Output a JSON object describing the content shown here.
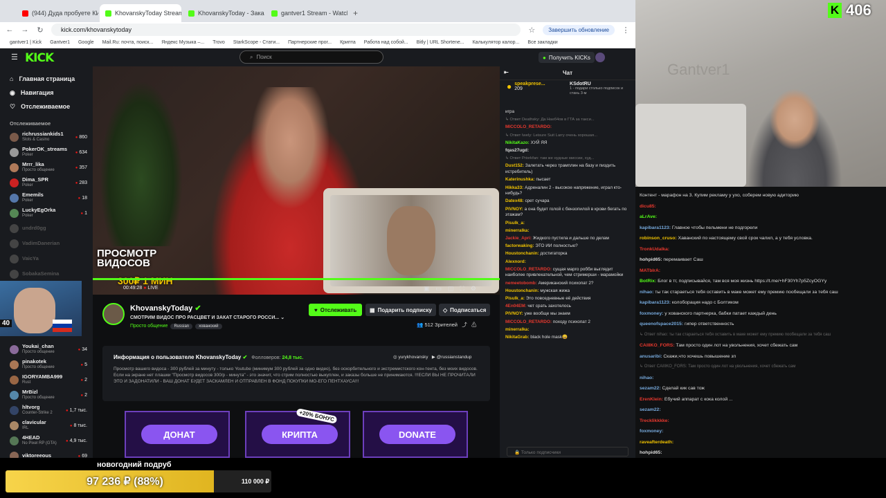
{
  "browser": {
    "tabs": [
      {
        "title": "(944) Дуда пробуете КИТАЙСК",
        "color": "#ff0000"
      },
      {
        "title": "KhovanskyToday Stream - Watch",
        "color": "#53fc18",
        "active": true
      },
      {
        "title": "KhovanskyToday - Заказ подпис",
        "color": "#53fc18"
      },
      {
        "title": "gantver1 Stream - Watch Live о",
        "color": "#53fc18"
      }
    ],
    "url": "kick.com/khovanskytoday",
    "update_label": "Завершить обновление",
    "bookmarks": [
      "gantver1 | Kick",
      "Gantver1",
      "Google",
      "Mail.Ru: почта, поиск...",
      "Яндекс Музыка –...",
      "Trovo",
      "StarkScope - Стати...",
      "Партнерские прог...",
      "Крипта",
      "Работа над собой...",
      "Bitly | URL Shortene...",
      "Калькулятор калор...",
      "Все закладки"
    ]
  },
  "kick": {
    "logo": "KICK",
    "search_placeholder": "Поиск",
    "get_kicks": "Получить KICKs",
    "nav": [
      {
        "label": "Главная страница",
        "icon": "home-icon"
      },
      {
        "label": "Навигация",
        "icon": "compass-icon"
      },
      {
        "label": "Отслеживаемое",
        "icon": "heart-icon"
      }
    ],
    "following_title": "Отслеживаемое",
    "following": [
      {
        "name": "richrussiankids1",
        "cat": "Slots & Casino",
        "count": "860",
        "color": "#7a5a4a"
      },
      {
        "name": "PokerOK_streams",
        "cat": "Poker",
        "count": "634",
        "color": "#999999"
      },
      {
        "name": "Mrrr_lika",
        "cat": "Просто общение",
        "count": "357",
        "color": "#b07a5a"
      },
      {
        "name": "Dima_SPR",
        "cat": "Poker",
        "count": "283",
        "color": "#cc2222"
      },
      {
        "name": "Ememils",
        "cat": "Poker",
        "count": "18",
        "color": "#5577aa"
      },
      {
        "name": "LuckyEgOrka",
        "cat": "Poker",
        "count": "1",
        "color": "#558855"
      },
      {
        "name": "undrd0gg",
        "cat": "",
        "count": "",
        "color": "#444444",
        "off": true
      },
      {
        "name": "VadimDanerian",
        "cat": "",
        "count": "",
        "color": "#444444",
        "off": true
      },
      {
        "name": "VaicYa",
        "cat": "",
        "count": "",
        "color": "#444444",
        "off": true
      },
      {
        "name": "SobakaSemina",
        "cat": "",
        "count": "",
        "color": "#444444",
        "off": true
      }
    ],
    "following2": [
      {
        "name": "Youkai_chan",
        "cat": "Просто общение",
        "count": "34",
        "color": "#8a6a9a"
      },
      {
        "name": "pinakotek",
        "cat": "Просто общение",
        "count": "5",
        "color": "#aa7755"
      },
      {
        "name": "IGORYAMBA999",
        "cat": "Rust",
        "count": "2",
        "color": "#996644"
      },
      {
        "name": "MrBizl",
        "cat": "Просто общение",
        "count": "2",
        "color": "#5588aa"
      },
      {
        "name": "hltvorg",
        "cat": "Counter-Strike 2",
        "count": "1,7 тыс.",
        "color": "#334466"
      },
      {
        "name": "clavicular",
        "cat": "IRL",
        "count": "8 тыс.",
        "color": "#aa8866"
      },
      {
        "name": "4HEAD",
        "cat": "No Pixel RP (GTA)",
        "count": "4,9 тыс.",
        "color": "#557755"
      },
      {
        "name": "viktoreeous",
        "cat": "",
        "count": "69",
        "color": "#886655"
      }
    ],
    "side_overlay_num": "40"
  },
  "video": {
    "promo_title": "ПРОСМОТР ВИДОСОВ",
    "promo_price": "300₽ 1 МИН",
    "time": "00:49:28",
    "live": "LIVE"
  },
  "channel": {
    "name": "KhovanskyToday",
    "title": "СМОТРИМ ВИДОС ПРО РАСЦВЕТ И ЗАКАТ СТАРОГО РОССИ...",
    "category": "Просто общение",
    "tags": [
      "Russian",
      "хованский"
    ],
    "follow_btn": "Отслеживать",
    "gift_btn": "Подарить подписку",
    "sub_btn": "Подписаться",
    "viewers": "512 Зрителей"
  },
  "about": {
    "title": "Информация о пользователе KhovanskyToday",
    "followers_label": "Фолловеров:",
    "followers": "24,8 тыс.",
    "socials": [
      "yurykhovansky",
      "@russianstandup"
    ],
    "text": "Просмотр вашего видоса - 300 рублей за минуту - только Youtube (минимум 300 рублей за одно видео), без оскорбительного и экстремистского кон-тента, без моих видосов. Если на экране нет плашки \"Просмотр видосов 300/р - минута\" - это значит, что стрим полностью выкуплен, и заказы больше не принимаются. !!!ЕСЛИ ВЫ НЕ ПРОЧИТАЛИ ЭТО И ЗАДОНАТИЛИ - ВАШ ДОНАТ БУДЕТ ЗАСКАМЛЕН И ОТПРАВЛЕН В ФОНД ПОКУПКИ МО-ЕГО ПЕНТХАУСА!!!"
  },
  "panels": [
    {
      "label": "ДОНАТ"
    },
    {
      "label": "КРИПТА",
      "bonus": "+20% БОНУС"
    },
    {
      "label": "DONATE"
    }
  ],
  "chat": {
    "title": "Чат",
    "pinned_user": "speakprese...",
    "pinned_count": "209",
    "pinned2_user": "KSdotRU",
    "pinned2_text": "1 - подари столько подписок и стань 3-м",
    "messages": [
      {
        "u": "",
        "t": "игра",
        "c": "#ddd"
      },
      {
        "sys": "↳ Ответ Deathsky: Да Наеб4ов в ГТА за такси..."
      },
      {
        "u": "MICCOLO_RETARDO:",
        "t": "",
        "c": "#e8382e"
      },
      {
        "sys": "↳ Ответ Iwely: Leisure Suit Larry очень хорошая..."
      },
      {
        "u": "NikitaKazo:",
        "t": "ХУЙ ЯЯ",
        "c": "#53fc18"
      },
      {
        "u": "fqas27ugd:",
        "t": "",
        "c": "#ddd"
      },
      {
        "sys": "↳ Ответ Priorkfan: там же нудные миссии, худ..."
      },
      {
        "u": "Dust152:",
        "t": "Залетать через трамплин на базу и пиздить истребитель)",
        "c": "#f2c400"
      },
      {
        "u": "Katerinushka:",
        "t": "пысает",
        "c": "#f2c400"
      },
      {
        "u": "Hikka33:",
        "t": "Адреналин 2 - высокое напряжение, играл кто-нибудь?",
        "c": "#f2c400"
      },
      {
        "u": "Datex48:",
        "t": "срет сучара",
        "c": "#f2c400"
      },
      {
        "u": "PIVNOY:",
        "t": "а она будет голой с бензопилой в крови бегать по этажам?",
        "c": "#f2c400"
      },
      {
        "u": "Pisulk_a:",
        "t": "",
        "c": "#f2c400"
      },
      {
        "u": "minerralka:",
        "t": "",
        "c": "#f2c400"
      },
      {
        "u": "Jackie_Apri:",
        "t": "Жидкого пустила и дальше по делам",
        "c": "#e8382e"
      },
      {
        "u": "factorwaking:",
        "t": "ЭТО ИИ полностью?",
        "c": "#f2c400"
      },
      {
        "u": "Houstonchanin:",
        "t": "достигаторка",
        "c": "#f2c400"
      },
      {
        "u": "Alexnord:",
        "t": "",
        "c": "#f2c400"
      },
      {
        "u": "MICCOLO_RETARDO:",
        "t": "сущая марго робби выглядит наиболее привлекательной, чем стримерши - марамойки",
        "c": "#e8382e"
      },
      {
        "u": "nemeetobomb:",
        "t": "Американский психопат 2?",
        "c": "#e8382e"
      },
      {
        "u": "Houstonchanin:",
        "t": "мужская жижа",
        "c": "#f2c400"
      },
      {
        "u": "Pisulk_a:",
        "t": "Это повседневные её действия",
        "c": "#f2c400"
      },
      {
        "u": "4En04EM:",
        "t": "чет срать захотелось",
        "c": "#e8382e"
      },
      {
        "u": "PIVNOY:",
        "t": "уже вообще мы знаем",
        "c": "#f2c400"
      },
      {
        "u": "MICCOLO_RETARDO:",
        "t": "походу психопат 2",
        "c": "#e8382e"
      },
      {
        "u": "minerralka:",
        "t": "",
        "c": "#f2c400"
      },
      {
        "u": "NikitaGrab:",
        "t": "black hole mask😀",
        "c": "#f2c400"
      }
    ],
    "input_placeholder": "Только подписчики"
  },
  "webcam": {
    "kick_count": "406",
    "wall_text": "Gantver1"
  },
  "rchat": {
    "messages": [
      {
        "u": "",
        "t": "Контент - марафон на 3. Купим рекламу у ухо, соберем новую адиторию",
        "c": "#e8382e"
      },
      {
        "u": "dicu85:",
        "t": "",
        "c": "#e8382e"
      },
      {
        "u": "aLrAve:",
        "t": "",
        "c": "#53fc18"
      },
      {
        "u": "kapibara1123:",
        "t": "Главное чтобы пельмени не подгорели",
        "c": "#7ad"
      },
      {
        "u": "robinson_cruso:",
        "t": "Хаванский по настоящему свой срок чалил, а у тебя условка.",
        "c": "#f2c400"
      },
      {
        "u": "TronkUdalka:",
        "t": "",
        "c": "#e8382e"
      },
      {
        "u": "hohpid65:",
        "t": "перемаивает Саш",
        "c": "#ddd"
      },
      {
        "u": "MATbIrA:",
        "t": "",
        "c": "#e8382e"
      },
      {
        "u": "BotRix:",
        "t": "Блог в тг, подписывайся, там вся моя жизнь https://t.me/+hF30Yh7p5ZcyOGYy",
        "c": "#53fc18"
      },
      {
        "u": "nihao:",
        "t": "ты так стараеться тебя оставить в макe может ему премию пообещали за тебя саш",
        "c": "#7ad"
      },
      {
        "u": "kapibara1123:",
        "t": "колоборация надо с Болтиком",
        "c": "#7ad"
      },
      {
        "u": "foxmoney:",
        "t": "у хованского партнерка, бабки патает каждый день",
        "c": "#7ad"
      },
      {
        "u": "queenofspace2015:",
        "t": "гипер ответственность",
        "c": "#7ad"
      },
      {
        "sys": "↳ Ответ nihao: ты так стараеться тебя оставить в макe может ему премию пообещали за тебя саш"
      },
      {
        "u": "CAIIIKO_FORS:",
        "t": "Там просто один лот на увольнения, хочет сбежать сам",
        "c": "#e8382e"
      },
      {
        "u": "anusaribi:",
        "t": "Скажи,что хочешь повышение зп",
        "c": "#7ad"
      },
      {
        "sys": "↳ Ответ CAIIIKO_FORS: Там просто один лот на увольнения, хочет сбежать сам"
      },
      {
        "u": "nihao:",
        "t": "",
        "c": "#7ad"
      },
      {
        "u": "sezam22:",
        "t": "Сделай кик сав тож",
        "c": "#7ad"
      },
      {
        "u": "ErenKlein:",
        "t": "Ебучий аппарат с кока колой ...",
        "c": "#e8382e"
      },
      {
        "u": "sezam22:",
        "t": "",
        "c": "#7ad"
      },
      {
        "u": "Trecklikkkke:",
        "t": "",
        "c": "#e8382e"
      },
      {
        "u": "foxmoney:",
        "t": "",
        "c": "#7ad"
      },
      {
        "u": "raveafterdeath:",
        "t": "",
        "c": "#f2c400"
      },
      {
        "u": "hohpid65:",
        "t": "",
        "c": "#ddd"
      }
    ]
  },
  "goal": {
    "title": "новогодний подруб",
    "current": "97 236 ₽ (88%)",
    "target": "110 000 ₽",
    "fraction": 0.88
  }
}
